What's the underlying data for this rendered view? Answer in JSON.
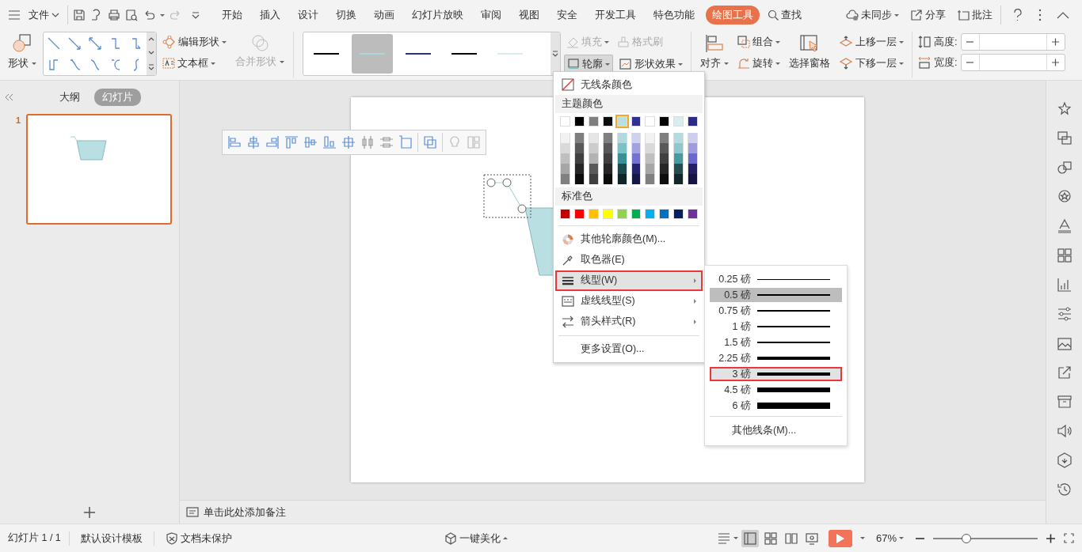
{
  "menu_button": {
    "label": "文件"
  },
  "tabs": [
    {
      "label": "开始",
      "selected": false
    },
    {
      "label": "插入",
      "selected": false
    },
    {
      "label": "设计",
      "selected": false
    },
    {
      "label": "切换",
      "selected": false
    },
    {
      "label": "动画",
      "selected": false
    },
    {
      "label": "幻灯片放映",
      "selected": false
    },
    {
      "label": "审阅",
      "selected": false
    },
    {
      "label": "视图",
      "selected": false
    },
    {
      "label": "安全",
      "selected": false
    },
    {
      "label": "开发工具",
      "selected": false
    },
    {
      "label": "特色功能",
      "selected": false
    },
    {
      "label": "绘图工具",
      "selected": true
    }
  ],
  "search": {
    "label": "查找"
  },
  "top_actions": [
    {
      "label": "未同步"
    },
    {
      "label": "分享"
    },
    {
      "label": "批注"
    }
  ],
  "ribbon": {
    "shape": {
      "label": "形状"
    },
    "edit_shape": {
      "label": "编辑形状"
    },
    "text_box": {
      "label": "文本框"
    },
    "merge_shapes": {
      "label": "合并形状",
      "disabled": true
    },
    "line_styles": [
      {
        "color": "#000000",
        "selected": false
      },
      {
        "color": "#a9d8dc",
        "selected": true
      },
      {
        "color": "#2e3192",
        "selected": false
      },
      {
        "color": "#000000",
        "selected": false
      },
      {
        "color": "#d9ecee",
        "selected": false
      }
    ],
    "fill": {
      "label": "填充",
      "disabled": true
    },
    "format_painter": {
      "label": "格式刷",
      "disabled": true
    },
    "outline": {
      "label": "轮廓",
      "expanded": true
    },
    "shape_effects": {
      "label": "形状效果"
    },
    "align": {
      "label": "对齐"
    },
    "group": {
      "label": "组合"
    },
    "rotate": {
      "label": "旋转"
    },
    "selection_pane": {
      "label": "选择窗格"
    },
    "bring_forward": {
      "label": "上移一层"
    },
    "send_backward": {
      "label": "下移一层"
    },
    "height": {
      "label": "高度:"
    },
    "width": {
      "label": "宽度:"
    }
  },
  "panel_tabs": [
    {
      "label": "大纲",
      "selected": false
    },
    {
      "label": "幻灯片",
      "selected": true
    }
  ],
  "slides": [
    {
      "number": "1",
      "selected": true
    }
  ],
  "notes": {
    "placeholder": "单击此处添加备注"
  },
  "outline_menu": {
    "no_line": "无线条颜色",
    "theme_header": "主题颜色",
    "theme_colors": [
      {
        "color": "#ffffff",
        "selected": false
      },
      {
        "color": "#000000",
        "selected": false
      },
      {
        "color": "#7f7f7f",
        "selected": false
      },
      {
        "color": "#0d0d0d",
        "selected": false
      },
      {
        "color": "#b9dfe2",
        "selected": true
      },
      {
        "color": "#2e3192",
        "selected": false
      },
      {
        "color": "#ffffff",
        "selected": false
      },
      {
        "color": "#000000",
        "selected": false
      },
      {
        "color": "#d9ecee",
        "selected": false
      },
      {
        "color": "#2e2a87",
        "selected": false
      }
    ],
    "shade_rows": [
      [
        {
          "color": "#f2f2f2"
        },
        {
          "color": "#7f7f7f"
        },
        {
          "color": "#e6e6e6"
        },
        {
          "color": "#808080"
        },
        {
          "color": "#b2dadd"
        },
        {
          "color": "#d0d0f0"
        },
        {
          "color": "#f2f2f2"
        },
        {
          "color": "#7f7f7f"
        },
        {
          "color": "#b3dcdf"
        },
        {
          "color": "#cfcdf0"
        }
      ],
      [
        {
          "color": "#d9d9d9"
        },
        {
          "color": "#595959"
        },
        {
          "color": "#cccccc"
        },
        {
          "color": "#595959"
        },
        {
          "color": "#7cc1c6"
        },
        {
          "color": "#a2a2e0"
        },
        {
          "color": "#d9d9d9"
        },
        {
          "color": "#595959"
        },
        {
          "color": "#8ec8cc"
        },
        {
          "color": "#9f9be0"
        }
      ],
      [
        {
          "color": "#bfbfbf"
        },
        {
          "color": "#404040"
        },
        {
          "color": "#b3b3b3"
        },
        {
          "color": "#404040"
        },
        {
          "color": "#3a8f95"
        },
        {
          "color": "#7373cf"
        },
        {
          "color": "#bfbfbf"
        },
        {
          "color": "#404040"
        },
        {
          "color": "#479a9f"
        },
        {
          "color": "#6c66cf"
        }
      ],
      [
        {
          "color": "#a6a6a6"
        },
        {
          "color": "#262626"
        },
        {
          "color": "#595959"
        },
        {
          "color": "#262626"
        },
        {
          "color": "#1d4a4d"
        },
        {
          "color": "#232370"
        },
        {
          "color": "#a6a6a6"
        },
        {
          "color": "#262626"
        },
        {
          "color": "#244e51"
        },
        {
          "color": "#221f66"
        }
      ],
      [
        {
          "color": "#808080"
        },
        {
          "color": "#0d0d0d"
        },
        {
          "color": "#3f3f3f"
        },
        {
          "color": "#0d0d0d"
        },
        {
          "color": "#0f2527"
        },
        {
          "color": "#161646"
        },
        {
          "color": "#808080"
        },
        {
          "color": "#0d0d0d"
        },
        {
          "color": "#122729"
        },
        {
          "color": "#161444"
        }
      ]
    ],
    "standard_header": "标准色",
    "standard_colors": [
      {
        "color": "#c00000"
      },
      {
        "color": "#ff0000"
      },
      {
        "color": "#ffc000"
      },
      {
        "color": "#ffff00"
      },
      {
        "color": "#92d050"
      },
      {
        "color": "#00b050"
      },
      {
        "color": "#00b0f0"
      },
      {
        "color": "#0070c0"
      },
      {
        "color": "#002060"
      },
      {
        "color": "#7030a0"
      }
    ],
    "items": [
      {
        "kind": "palette",
        "label": "其他轮廓颜色(M)...",
        "highlighted": false,
        "submenu": false
      },
      {
        "kind": "eyedropper",
        "label": "取色器(E)",
        "highlighted": false,
        "submenu": false
      },
      {
        "kind": "weight",
        "label": "线型(W)",
        "highlighted": true,
        "submenu": true
      },
      {
        "kind": "dash",
        "label": "虚线线型(S)",
        "highlighted": false,
        "submenu": true
      },
      {
        "kind": "arrow",
        "label": "箭头样式(R)",
        "highlighted": false,
        "submenu": true
      },
      {
        "kind": "more",
        "label": "更多设置(O)...",
        "highlighted": false,
        "submenu": false
      }
    ]
  },
  "weight_menu": {
    "items": [
      {
        "label": "0.25 磅",
        "selected": false,
        "highlighted": false
      },
      {
        "label": "0.5 磅",
        "selected": true,
        "highlighted": false
      },
      {
        "label": "0.75 磅",
        "selected": false,
        "highlighted": false
      },
      {
        "label": "1 磅",
        "selected": false,
        "highlighted": false
      },
      {
        "label": "1.5 磅",
        "selected": false,
        "highlighted": false
      },
      {
        "label": "2.25 磅",
        "selected": false,
        "highlighted": false
      },
      {
        "label": "3 磅",
        "selected": false,
        "highlighted": true
      },
      {
        "label": "4.5 磅",
        "selected": false,
        "highlighted": false
      },
      {
        "label": "6 磅",
        "selected": false,
        "highlighted": false
      }
    ],
    "more": "其他线条(M)..."
  },
  "status_bar": {
    "slide_info": "幻灯片 1 / 1",
    "template": "默认设计模板",
    "protection": "文档未保护",
    "beautify": "一键美化",
    "views": [
      {
        "selected": true
      },
      {
        "selected": false
      },
      {
        "selected": false
      },
      {
        "selected": false
      }
    ],
    "zoom": "67%",
    "zoom_slider": {
      "level": 0.32
    }
  }
}
